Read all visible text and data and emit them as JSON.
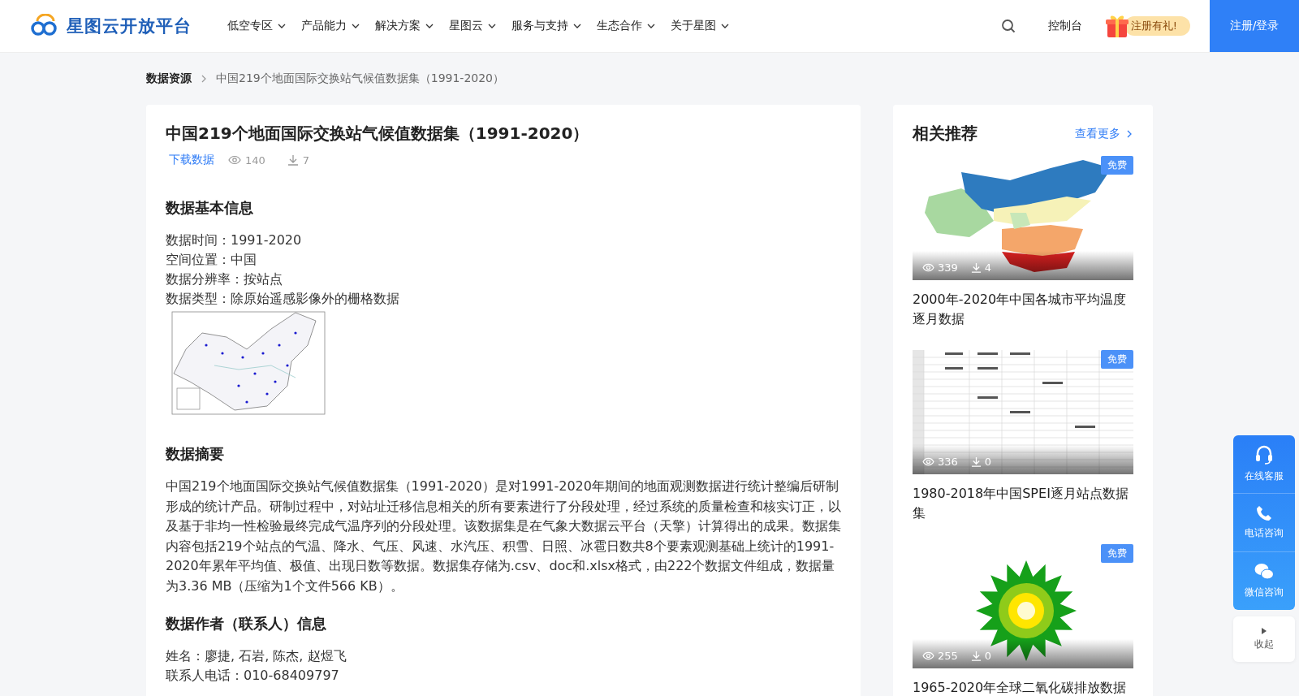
{
  "header": {
    "logo": "星图云开放平台",
    "nav": [
      {
        "label": "低空专区"
      },
      {
        "label": "产品能力"
      },
      {
        "label": "解决方案"
      },
      {
        "label": "星图云"
      },
      {
        "label": "服务与支持"
      },
      {
        "label": "生态合作"
      },
      {
        "label": "关于星图"
      }
    ],
    "console": "控制台",
    "promo": "注册有礼!",
    "login": "注册/登录"
  },
  "breadcrumb": [
    "数据资源",
    "中国219个地面国际交换站气候值数据集（1991-2020）"
  ],
  "dataset": {
    "title": "中国219个地面国际交换站气候值数据集（1991-2020）",
    "download": "下载数据",
    "views": "140",
    "downloads": "7",
    "blocks": [
      {
        "kind": "heading",
        "text": "数据基本信息"
      },
      {
        "kind": "lines",
        "lines": [
          "数据时间：1991-2020",
          "空间位置：中国",
          "数据分辨率：按站点",
          "数据类型：除原始遥感影像外的栅格数据"
        ]
      },
      {
        "kind": "picture"
      },
      {
        "kind": "heading",
        "text": "数据摘要"
      },
      {
        "kind": "paragraph",
        "text": "中国219个地面国际交换站气候值数据集（1991-2020）是对1991-2020年期间的地面观测数据进行统计整编后研制形成的统计产品。研制过程中，对站址迁移信息相关的所有要素进行了分段处理，经过系统的质量检查和核实订正，以及基于非均一性检验最终完成气温序列的分段处理。该数据集是在气象大数据云平台（天擎）计算得出的成果。数据集内容包括219个站点的气温、降水、气压、风速、水汽压、积雪、日照、冰雹日数共8个要素观测基础上统计的1991-2020年累年平均值、极值、出现日数等数据。数据集存储为.csv、doc和.xlsx格式，由222个数据文件组成，数据量为3.36 MB（压缩为1个文件566 KB）。"
      },
      {
        "kind": "heading",
        "text": "数据作者（联系人）信息"
      },
      {
        "kind": "lines",
        "lines": [
          "姓名：廖捷, 石岩, 陈杰, 赵煜飞",
          "联系人电话：010-68409797"
        ]
      }
    ]
  },
  "related": {
    "title": "相关推荐",
    "more": "查看更多",
    "items": [
      {
        "kind": "map",
        "badge": "免费",
        "views": "339",
        "downloads": "4",
        "title": "2000年-2020年中国各城市平均温度逐月数据"
      },
      {
        "kind": "table",
        "badge": "免费",
        "views": "336",
        "downloads": "0",
        "title": "1980-2018年中国SPEI逐月站点数据集"
      },
      {
        "kind": "flower",
        "badge": "免费",
        "views": "255",
        "downloads": "0",
        "title": "1965-2020年全球二氧化碳排放数据"
      }
    ]
  },
  "float": {
    "items": [
      {
        "kind": "headset",
        "label": "在线客服"
      },
      {
        "kind": "phone",
        "label": "电话咨询"
      },
      {
        "kind": "chat",
        "label": "微信咨询"
      }
    ],
    "collapse": "收起"
  }
}
